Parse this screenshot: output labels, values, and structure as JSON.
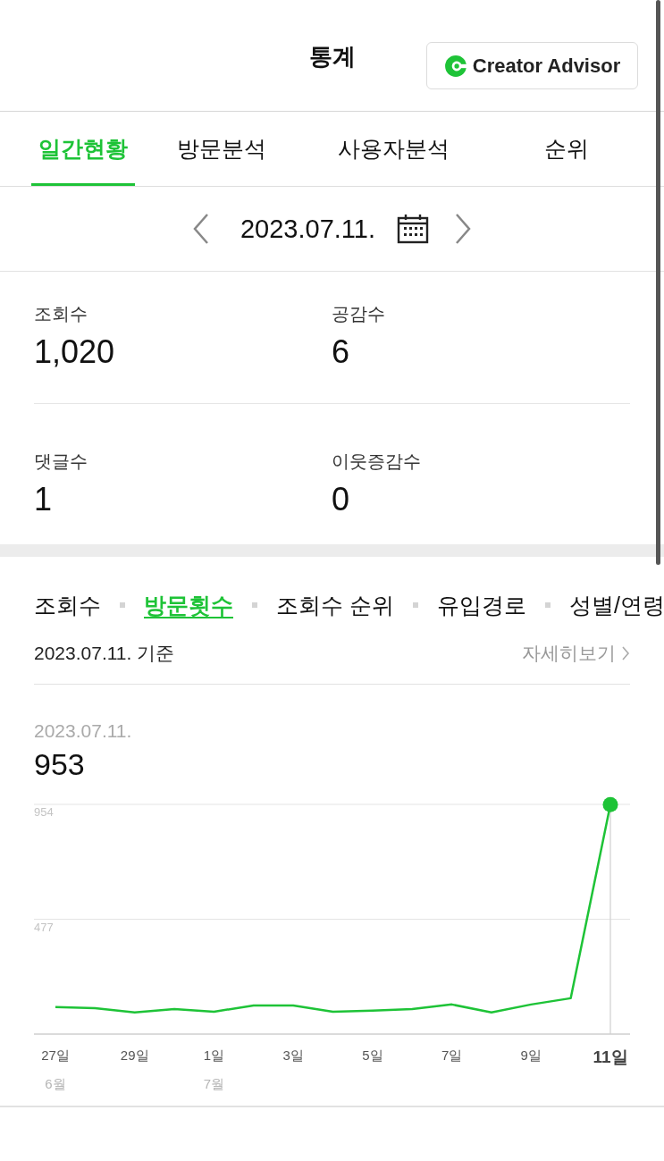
{
  "header": {
    "title": "통계",
    "advisor_button": "Creator Advisor"
  },
  "tabs": [
    {
      "label": "일간현황",
      "selected": true
    },
    {
      "label": "방문분석",
      "selected": false
    },
    {
      "label": "사용자분석",
      "selected": false
    },
    {
      "label": "순위",
      "selected": false
    }
  ],
  "date_nav": {
    "date": "2023.07.11."
  },
  "stats": [
    {
      "label": "조회수",
      "value": "1,020"
    },
    {
      "label": "공감수",
      "value": "6"
    },
    {
      "label": "댓글수",
      "value": "1"
    },
    {
      "label": "이웃증감수",
      "value": "0"
    }
  ],
  "sub_tabs": [
    {
      "label": "조회수",
      "selected": false
    },
    {
      "label": "방문횟수",
      "selected": true
    },
    {
      "label": "조회수 순위",
      "selected": false
    },
    {
      "label": "유입경로",
      "selected": false
    },
    {
      "label": "성별/연령",
      "selected": false
    }
  ],
  "report": {
    "basis": "2023.07.11. 기준",
    "detail_link": "자세히보기",
    "selected_date": "2023.07.11.",
    "selected_value": "953"
  },
  "chart_data": {
    "type": "line",
    "categories": [
      "27일\n6월",
      null,
      "29일",
      null,
      "1일\n7월",
      null,
      "3일",
      null,
      "5일",
      null,
      "7일",
      null,
      "9일",
      null,
      "11일"
    ],
    "series": [
      {
        "color": "#1ec337",
        "values": [
          112,
          108,
          90,
          104,
          93,
          119,
          119,
          93,
          97,
          104,
          123,
          90,
          123,
          149,
          953
        ]
      }
    ],
    "ylim": [
      0,
      954
    ],
    "yticks": [
      477,
      954
    ],
    "ref_lines": [
      {
        "axis": "y",
        "value": 477
      },
      {
        "axis": "y",
        "value": 954
      },
      {
        "axis": "x",
        "value": "11일"
      }
    ]
  }
}
